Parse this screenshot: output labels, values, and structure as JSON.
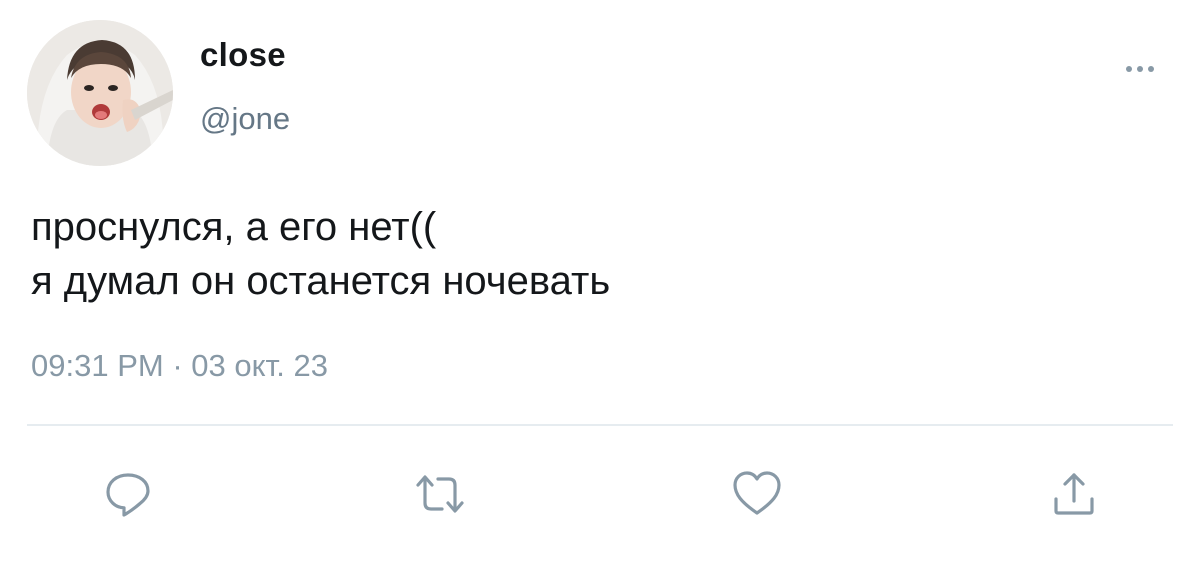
{
  "user": {
    "display_name": "close",
    "handle": "@jone",
    "avatar_icon": "profile-photo"
  },
  "tweet": {
    "text": "проснулся, а его нет((\nя думал он останется ночевать",
    "time": "09:31 PM",
    "separator": "·",
    "date": "03 окт. 23"
  },
  "actions": {
    "more_icon": "more-options-icon",
    "reply_icon": "reply-icon",
    "retweet_icon": "retweet-icon",
    "like_icon": "heart-icon",
    "share_icon": "share-icon"
  },
  "colors": {
    "text": "#14171a",
    "secondary": "#8899a6",
    "handle": "#657786",
    "divider": "#e6ecf0",
    "icon": "#8899a6"
  }
}
